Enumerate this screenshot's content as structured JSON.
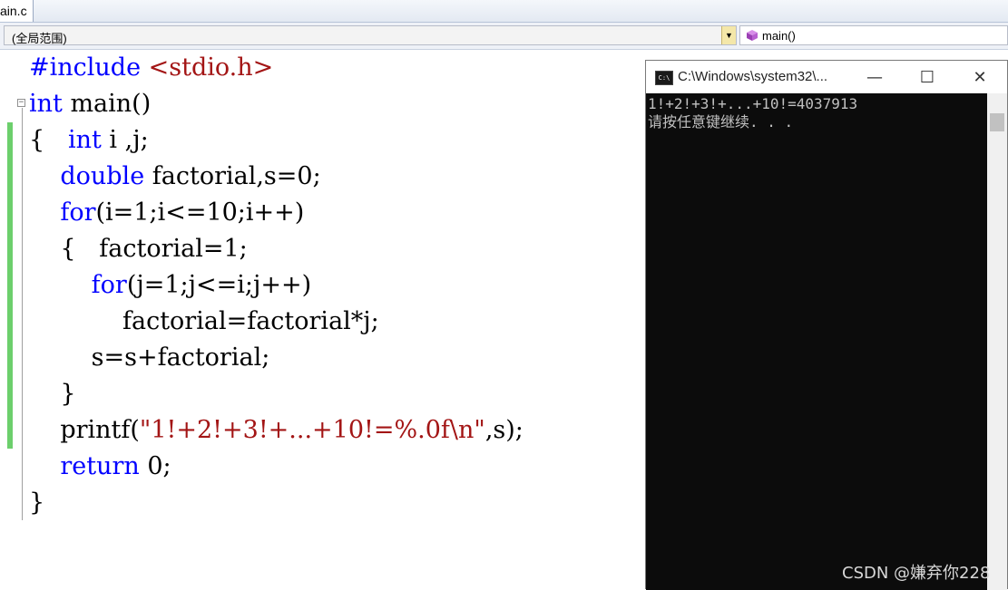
{
  "tab": {
    "title": "ain.c"
  },
  "navbar": {
    "scope": "(全局范围)",
    "function": "main()"
  },
  "code": {
    "l1_directive": "#include",
    "l1_header": "<stdio.h>",
    "l2_type": "int",
    "l2_rest": " main()",
    "l3_brace": "{   ",
    "l3_type": "int",
    "l3_rest": " i ,j;",
    "l4_indent": "    ",
    "l4_type": "double",
    "l4_rest": " factorial,s=0;",
    "l5_indent": "    ",
    "l5_kw": "for",
    "l5_rest": "(i=1;i<=10;i++)",
    "l6": "    {   factorial=1;",
    "l7_indent": "        ",
    "l7_kw": "for",
    "l7_rest": "(j=1;j<=i;j++)",
    "l8": "            factorial=factorial*j;",
    "l9": "        s=s+factorial;",
    "l10": "    }",
    "l11_pre": "    printf(",
    "l11_str": "\"1!+2!+3!+...+10!=%.0f\\n\"",
    "l11_post": ",s);",
    "l12_indent": "    ",
    "l12_kw": "return",
    "l12_rest": " 0;",
    "l13": "}"
  },
  "console": {
    "title": "C:\\Windows\\system32\\...",
    "minimize": "—",
    "maximize": "☐",
    "close": "✕",
    "output_line1": "1!+2!+3!+...+10!=4037913",
    "output_line2": "请按任意键继续. . ."
  },
  "watermark": "CSDN @嫌弃你228",
  "icons": {
    "function_icon": "purple-cube-icon",
    "console_icon": "cmd-icon"
  }
}
